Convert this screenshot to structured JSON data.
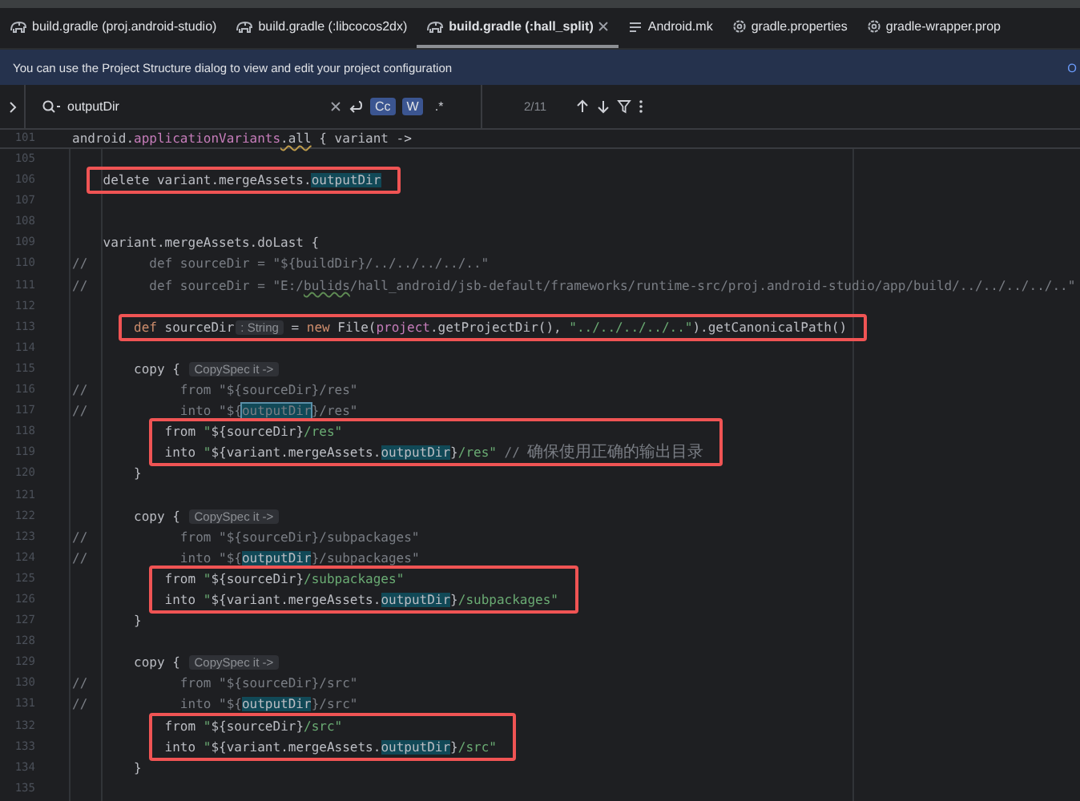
{
  "tabs": [
    {
      "label": "build.gradle (proj.android-studio)",
      "kind": "gradle",
      "selected": false
    },
    {
      "label": "build.gradle (:libcocos2dx)",
      "kind": "gradle",
      "selected": false
    },
    {
      "label": "build.gradle (:hall_split)",
      "kind": "gradle",
      "selected": true
    },
    {
      "label": "Android.mk",
      "kind": "lines",
      "selected": false
    },
    {
      "label": "gradle.properties",
      "kind": "gear",
      "selected": false
    },
    {
      "label": "gradle-wrapper.prop",
      "kind": "gear",
      "selected": false
    }
  ],
  "banner": {
    "text": "You can use the Project Structure dialog to view and edit your project configuration",
    "action": "O"
  },
  "search": {
    "value": "outputDir",
    "options": [
      {
        "label": "Cc",
        "selected": true
      },
      {
        "label": "W",
        "selected": true
      },
      {
        "label": ".*",
        "selected": false
      }
    ],
    "count": "2/11"
  },
  "sticky_line": {
    "number": "101",
    "tokens": [
      {
        "kind": "plain",
        "text": "android."
      },
      {
        "kind": "field",
        "text": "applicationVariants"
      },
      {
        "kind": "warn",
        "text": ".all"
      },
      {
        "kind": "plain",
        "text": " { variant ->"
      }
    ]
  },
  "lines": [
    {
      "kind": "line",
      "number": "105"
    },
    {
      "kind": "annotated",
      "lines": [
        {
          "number": "106",
          "tokens": [
            {
              "kind": "plain",
              "text": "    delete variant.mergeAssets."
            },
            {
              "kind": "match",
              "text": "outputDir"
            }
          ]
        }
      ]
    },
    {
      "kind": "line",
      "number": "107"
    },
    {
      "kind": "line",
      "number": "108"
    },
    {
      "kind": "line",
      "number": "109",
      "tokens": [
        {
          "kind": "plain",
          "text": "    variant.mergeAssets.doLast {"
        }
      ]
    },
    {
      "kind": "line",
      "number": "110",
      "tokens": [
        {
          "kind": "comment",
          "text": "//        def sourceDir = \"${buildDir}/../../../../..\""
        }
      ]
    },
    {
      "kind": "line",
      "number": "111",
      "tokens": [
        {
          "kind": "comment",
          "text": "//        def sourceDir = \"E:/"
        },
        {
          "kind": "typo",
          "text": "bulids"
        },
        {
          "kind": "comment",
          "text": "/hall_android/jsb-default/frameworks/runtime-src/proj.android-studio/app/build/../../../../..\""
        }
      ]
    },
    {
      "kind": "line",
      "number": "112"
    },
    {
      "kind": "annotated",
      "lines": [
        {
          "number": "113",
          "tokens": [
            {
              "kind": "keyword",
              "text": "        def"
            },
            {
              "kind": "plain",
              "text": " sourceDir"
            },
            {
              "kind": "hint",
              "text": ": String"
            },
            {
              "kind": "plain",
              "text": " = "
            },
            {
              "kind": "keyword",
              "text": "new"
            },
            {
              "kind": "plain",
              "text": " File("
            },
            {
              "kind": "field",
              "text": "project"
            },
            {
              "kind": "plain",
              "text": ".getProjectDir(), "
            },
            {
              "kind": "string",
              "text": "\"../../../../..\""
            },
            {
              "kind": "plain",
              "text": ").getCanonicalPath()"
            }
          ]
        }
      ]
    },
    {
      "kind": "line",
      "number": "114"
    },
    {
      "kind": "line",
      "number": "115",
      "tokens": [
        {
          "kind": "plain",
          "text": "        copy { "
        },
        {
          "kind": "hint",
          "text": "CopySpec it ->"
        }
      ]
    },
    {
      "kind": "line",
      "number": "116",
      "tokens": [
        {
          "kind": "comment",
          "text": "//            from \"${sourceDir}/res\""
        }
      ]
    },
    {
      "kind": "line",
      "number": "117",
      "tokens": [
        {
          "kind": "comment",
          "text": "//            into \"${"
        },
        {
          "kind": "match-current",
          "text": "outputDir"
        },
        {
          "kind": "comment",
          "text": "}/res\""
        }
      ]
    },
    {
      "kind": "annotated",
      "lines": [
        {
          "number": "118",
          "tokens": [
            {
              "kind": "plain",
              "text": "            from "
            },
            {
              "kind": "string",
              "text": "\""
            },
            {
              "kind": "plain",
              "text": "${sourceDir}"
            },
            {
              "kind": "string",
              "text": "/res\""
            }
          ]
        },
        {
          "number": "119",
          "tokens": [
            {
              "kind": "plain",
              "text": "            into "
            },
            {
              "kind": "string",
              "text": "\""
            },
            {
              "kind": "plain",
              "text": "${variant.mergeAssets."
            },
            {
              "kind": "match",
              "text": "outputDir"
            },
            {
              "kind": "plain",
              "text": "}"
            },
            {
              "kind": "string",
              "text": "/res\""
            },
            {
              "kind": "comment",
              "text": " // "
            },
            {
              "kind": "cjk",
              "text": "确保使用正确的输出目录"
            }
          ]
        }
      ]
    },
    {
      "kind": "line",
      "number": "120",
      "tokens": [
        {
          "kind": "plain",
          "text": "        }"
        }
      ]
    },
    {
      "kind": "line",
      "number": "121"
    },
    {
      "kind": "line",
      "number": "122",
      "tokens": [
        {
          "kind": "plain",
          "text": "        copy { "
        },
        {
          "kind": "hint",
          "text": "CopySpec it ->"
        }
      ]
    },
    {
      "kind": "line",
      "number": "123",
      "tokens": [
        {
          "kind": "comment",
          "text": "//            from \"${sourceDir}/subpackages\""
        }
      ]
    },
    {
      "kind": "line",
      "number": "124",
      "tokens": [
        {
          "kind": "comment",
          "text": "//            into \"${"
        },
        {
          "kind": "match",
          "text": "outputDir"
        },
        {
          "kind": "comment",
          "text": "}/subpackages\""
        }
      ]
    },
    {
      "kind": "annotated",
      "lines": [
        {
          "number": "125",
          "tokens": [
            {
              "kind": "plain",
              "text": "            from "
            },
            {
              "kind": "string",
              "text": "\""
            },
            {
              "kind": "plain",
              "text": "${sourceDir}"
            },
            {
              "kind": "string",
              "text": "/subpackages\""
            }
          ]
        },
        {
          "number": "126",
          "tokens": [
            {
              "kind": "plain",
              "text": "            into "
            },
            {
              "kind": "string",
              "text": "\""
            },
            {
              "kind": "plain",
              "text": "${variant.mergeAssets."
            },
            {
              "kind": "match",
              "text": "outputDir"
            },
            {
              "kind": "plain",
              "text": "}"
            },
            {
              "kind": "string",
              "text": "/subpackages\""
            }
          ]
        }
      ]
    },
    {
      "kind": "line",
      "number": "127",
      "tokens": [
        {
          "kind": "plain",
          "text": "        }"
        }
      ]
    },
    {
      "kind": "line",
      "number": "128"
    },
    {
      "kind": "line",
      "number": "129",
      "tokens": [
        {
          "kind": "plain",
          "text": "        copy { "
        },
        {
          "kind": "hint",
          "text": "CopySpec it ->"
        }
      ]
    },
    {
      "kind": "line",
      "number": "130",
      "tokens": [
        {
          "kind": "comment",
          "text": "//            from \"${sourceDir}/src\""
        }
      ]
    },
    {
      "kind": "line",
      "number": "131",
      "tokens": [
        {
          "kind": "comment",
          "text": "//            into \"${"
        },
        {
          "kind": "match",
          "text": "outputDir"
        },
        {
          "kind": "comment",
          "text": "}/src\""
        }
      ]
    },
    {
      "kind": "annotated",
      "lines": [
        {
          "number": "132",
          "tokens": [
            {
              "kind": "plain",
              "text": "            from "
            },
            {
              "kind": "string",
              "text": "\""
            },
            {
              "kind": "plain",
              "text": "${sourceDir}"
            },
            {
              "kind": "string",
              "text": "/src\""
            }
          ]
        },
        {
          "number": "133",
          "tokens": [
            {
              "kind": "plain",
              "text": "            into "
            },
            {
              "kind": "string",
              "text": "\""
            },
            {
              "kind": "plain",
              "text": "${variant.mergeAssets."
            },
            {
              "kind": "match",
              "text": "outputDir"
            },
            {
              "kind": "plain",
              "text": "}"
            },
            {
              "kind": "string",
              "text": "/src\""
            }
          ]
        }
      ]
    },
    {
      "kind": "line",
      "number": "134",
      "tokens": [
        {
          "kind": "plain",
          "text": "        }"
        }
      ]
    },
    {
      "kind": "line",
      "number": "135"
    }
  ]
}
